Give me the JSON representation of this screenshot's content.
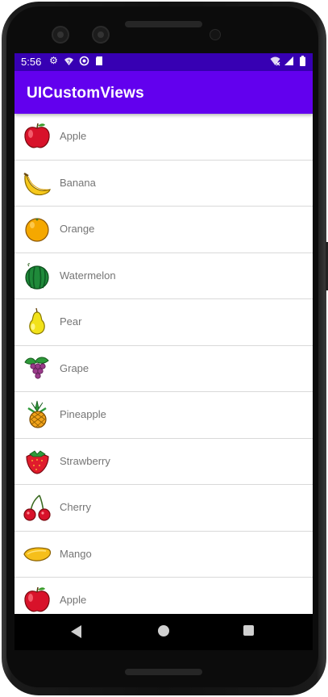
{
  "status_bar": {
    "time": "5:56",
    "left_icons": [
      "gear-icon",
      "wifi-question-icon",
      "at-icon",
      "sd-card-icon"
    ],
    "right_icons": [
      "wifi-off-icon",
      "signal-icon",
      "battery-icon"
    ]
  },
  "app_bar": {
    "title": "UICustomViews"
  },
  "fruits": [
    {
      "name": "Apple",
      "icon": "apple-icon"
    },
    {
      "name": "Banana",
      "icon": "banana-icon"
    },
    {
      "name": "Orange",
      "icon": "orange-icon"
    },
    {
      "name": "Watermelon",
      "icon": "watermelon-icon"
    },
    {
      "name": "Pear",
      "icon": "pear-icon"
    },
    {
      "name": "Grape",
      "icon": "grape-icon"
    },
    {
      "name": "Pineapple",
      "icon": "pineapple-icon"
    },
    {
      "name": "Strawberry",
      "icon": "strawberry-icon"
    },
    {
      "name": "Cherry",
      "icon": "cherry-icon"
    },
    {
      "name": "Mango",
      "icon": "mango-icon"
    },
    {
      "name": "Apple",
      "icon": "apple-icon"
    }
  ],
  "nav_bar": {
    "buttons": [
      "back-icon",
      "home-icon",
      "recents-icon"
    ]
  },
  "colors": {
    "status_bar": "#3700b3",
    "app_bar": "#6200ee",
    "divider": "#d9d9d9",
    "label": "#757575"
  }
}
